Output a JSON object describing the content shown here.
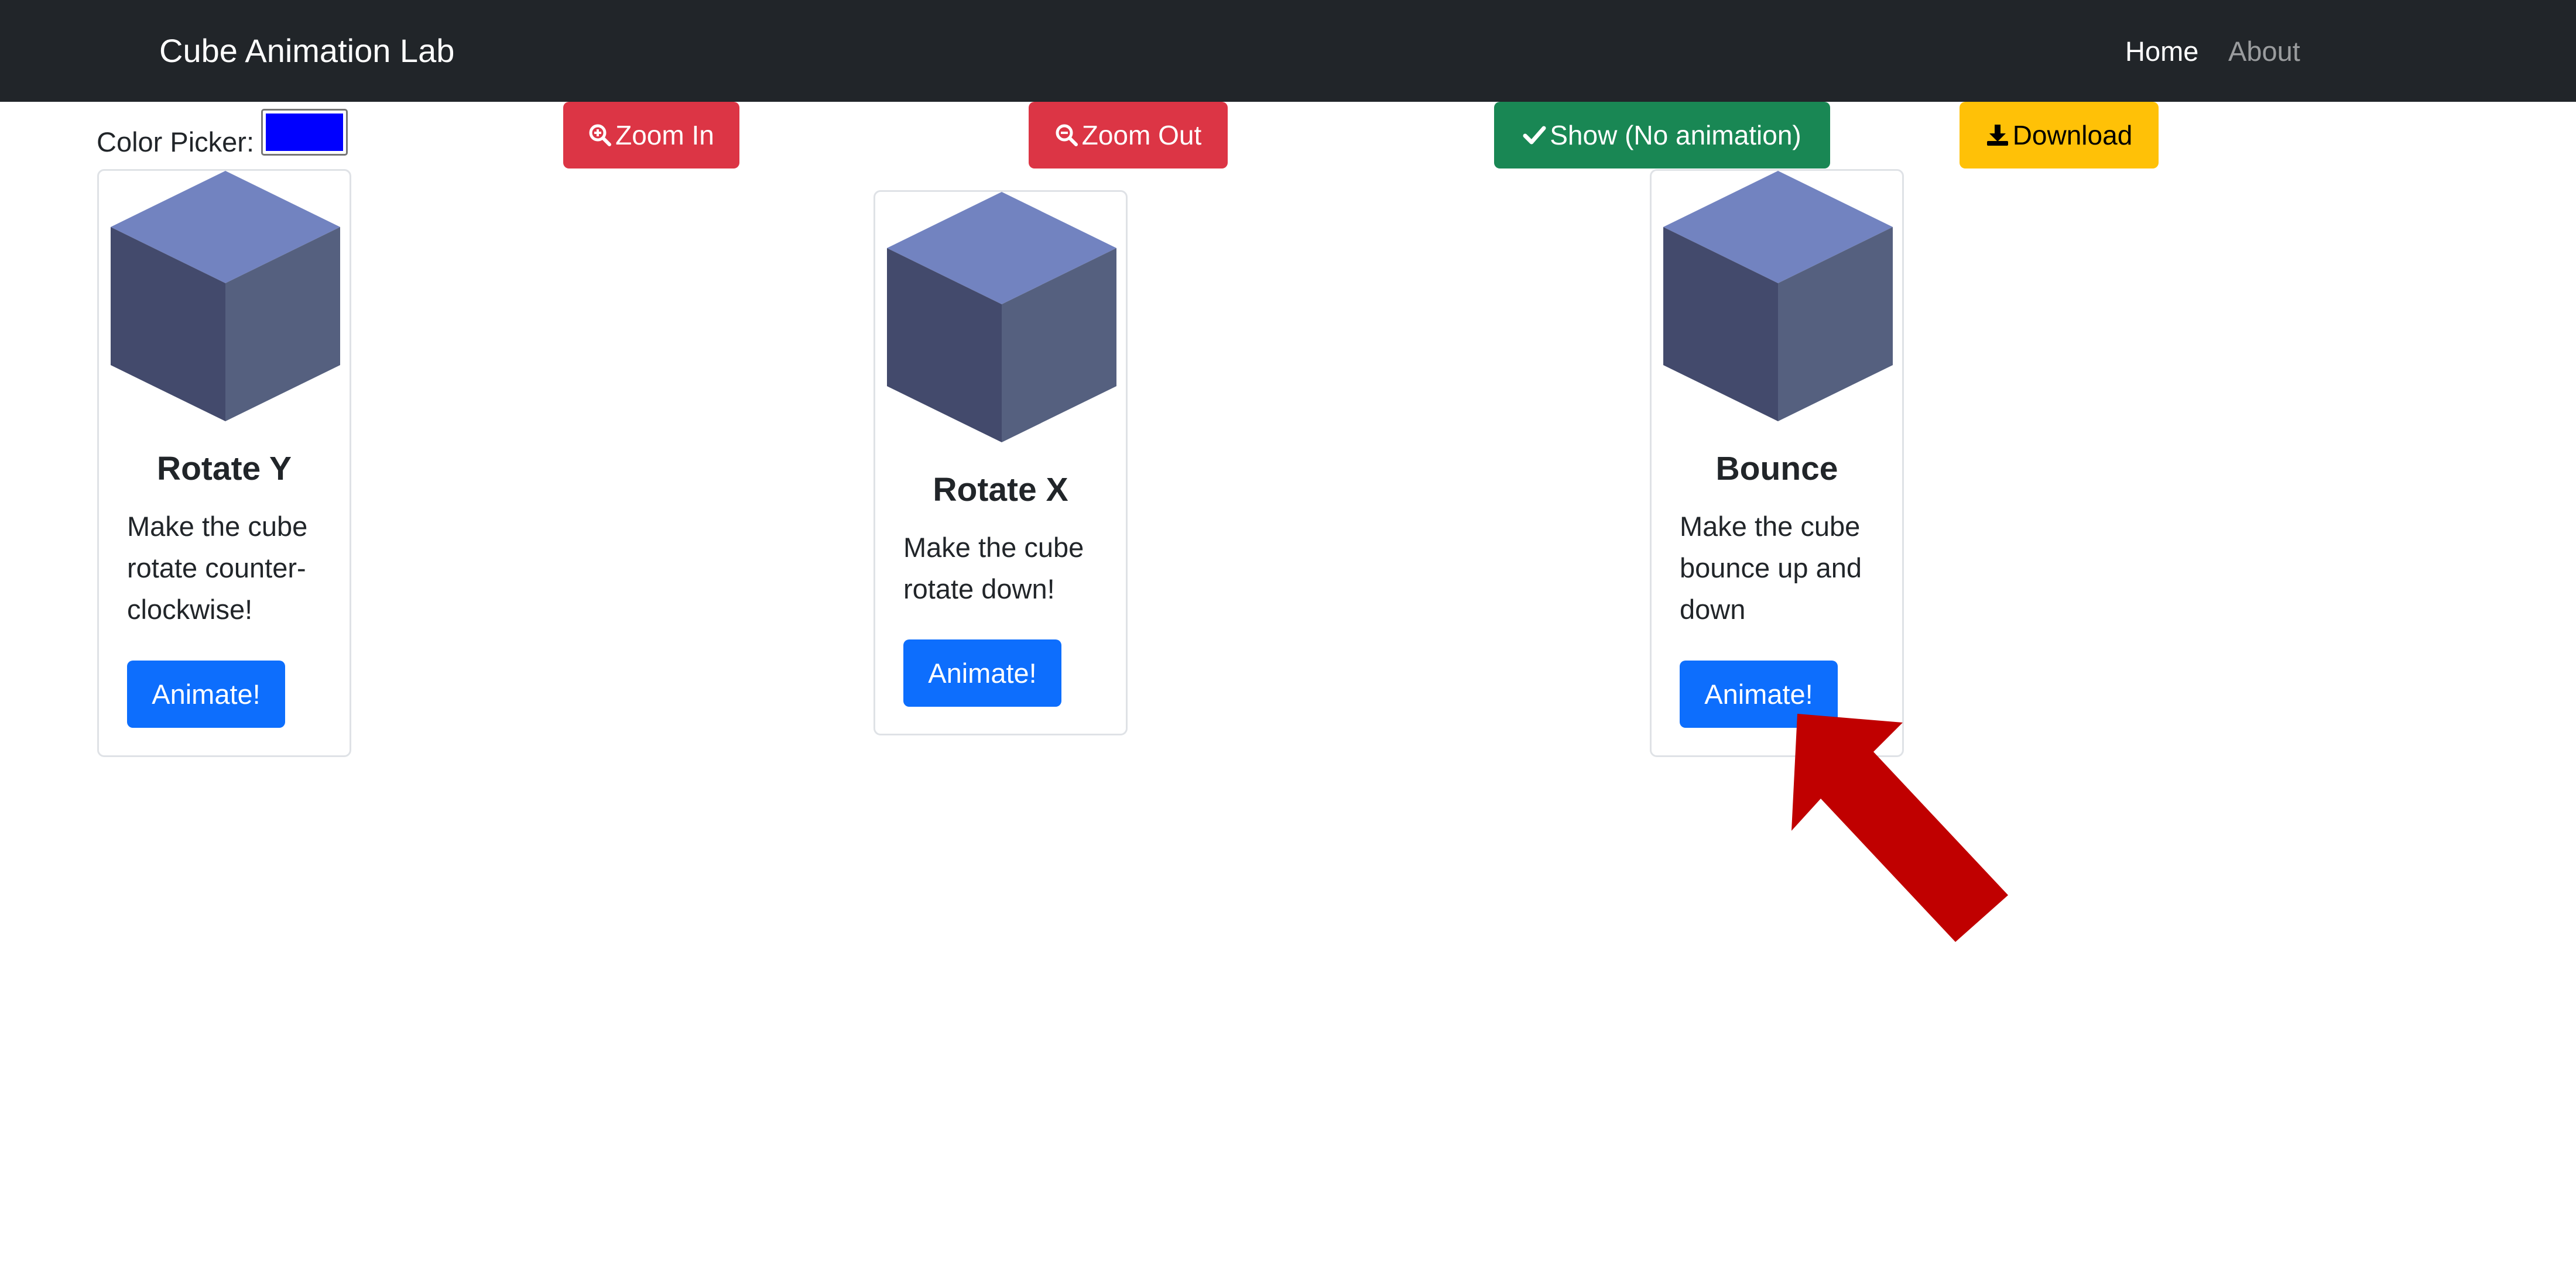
{
  "navbar": {
    "brand": "Cube Animation Lab",
    "links": [
      {
        "label": "Home",
        "active": true
      },
      {
        "label": "About",
        "active": false
      }
    ]
  },
  "toolbar": {
    "color_picker_label": "Color Picker:",
    "color_value": "#0000ff",
    "zoom_in_label": "Zoom In",
    "zoom_out_label": "Zoom Out",
    "show_label": "Show (No animation)",
    "download_label": "Download"
  },
  "cards": [
    {
      "title": "Rotate Y",
      "text": "Make the cube rotate counter-clockwise!",
      "button": "Animate!"
    },
    {
      "title": "Rotate X",
      "text": "Make the cube rotate down!",
      "button": "Animate!"
    },
    {
      "title": "Bounce",
      "text": "Make the cube bounce up and down",
      "button": "Animate!"
    }
  ],
  "colors": {
    "navbar_bg": "#212529",
    "danger": "#dc3545",
    "success": "#198754",
    "warning": "#ffc107",
    "primary": "#0d6efd",
    "cube_top": "#7283c0",
    "cube_left": "#434a6c",
    "cube_right": "#55607f",
    "arrow": "#c00000"
  },
  "icons": {
    "zoom_in": "zoom-in-icon",
    "zoom_out": "zoom-out-icon",
    "show": "check-icon",
    "download": "download-icon",
    "annotation": "red-arrow-annotation"
  }
}
